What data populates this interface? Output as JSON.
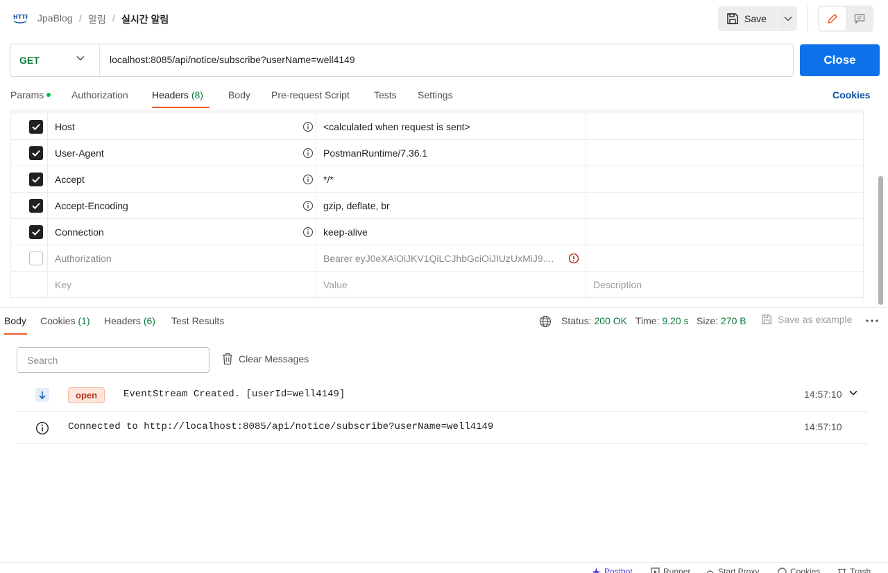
{
  "breadcrumb": {
    "collection": "JpaBlog",
    "separator": "/",
    "folder": "알림",
    "request": "실시간 알림"
  },
  "toolbar": {
    "save_label": "Save"
  },
  "request": {
    "method": "GET",
    "url": "localhost:8085/api/notice/subscribe?userName=well4149",
    "close_label": "Close"
  },
  "request_tabs": {
    "params": "Params",
    "authorization": "Authorization",
    "headers": "Headers",
    "headers_count": "(8)",
    "body": "Body",
    "prerequest": "Pre-request Script",
    "tests": "Tests",
    "settings": "Settings",
    "cookies": "Cookies"
  },
  "headers": [
    {
      "key": "Host",
      "value": "<calculated when request is sent>",
      "checked": true
    },
    {
      "key": "User-Agent",
      "value": "PostmanRuntime/7.36.1",
      "checked": true
    },
    {
      "key": "Accept",
      "value": "*/*",
      "checked": true
    },
    {
      "key": "Accept-Encoding",
      "value": "gzip, deflate, br",
      "checked": true
    },
    {
      "key": "Connection",
      "value": "keep-alive",
      "checked": true
    },
    {
      "key": "Authorization",
      "value": "Bearer eyJ0eXAiOiJKV1QiLCJhbGciOiJIUzUxMiJ9....",
      "checked": false
    }
  ],
  "headers_placeholder": {
    "key": "Key",
    "value": "Value",
    "description": "Description"
  },
  "response_tabs": {
    "body": "Body",
    "cookies": "Cookies",
    "cookies_count": "(1)",
    "headers": "Headers",
    "headers_count": "(6)",
    "test_results": "Test Results"
  },
  "response_status": {
    "status_label": "Status:",
    "status_value": "200 OK",
    "time_label": "Time:",
    "time_value": "9.20 s",
    "size_label": "Size:",
    "size_value": "270 B",
    "save_example": "Save as example"
  },
  "messages_toolbar": {
    "search_placeholder": "Search",
    "clear_label": "Clear Messages"
  },
  "messages": [
    {
      "badge": "open",
      "text": "EventStream Created. [userId=well4149]",
      "time": "14:57:10"
    },
    {
      "text": "Connected to http://localhost:8085/api/notice/subscribe?userName=well4149",
      "time": "14:57:10"
    }
  ],
  "bottom_bar": {
    "postbot": "Postbot",
    "runner": "Runner",
    "start_proxy": "Start Proxy",
    "cookies": "Cookies",
    "trash": "Trash"
  },
  "colors": {
    "accent": "#ef5b25",
    "primary_button": "#0d71e9",
    "method_get": "#0b7a3e",
    "open_badge": "#b4341b"
  }
}
